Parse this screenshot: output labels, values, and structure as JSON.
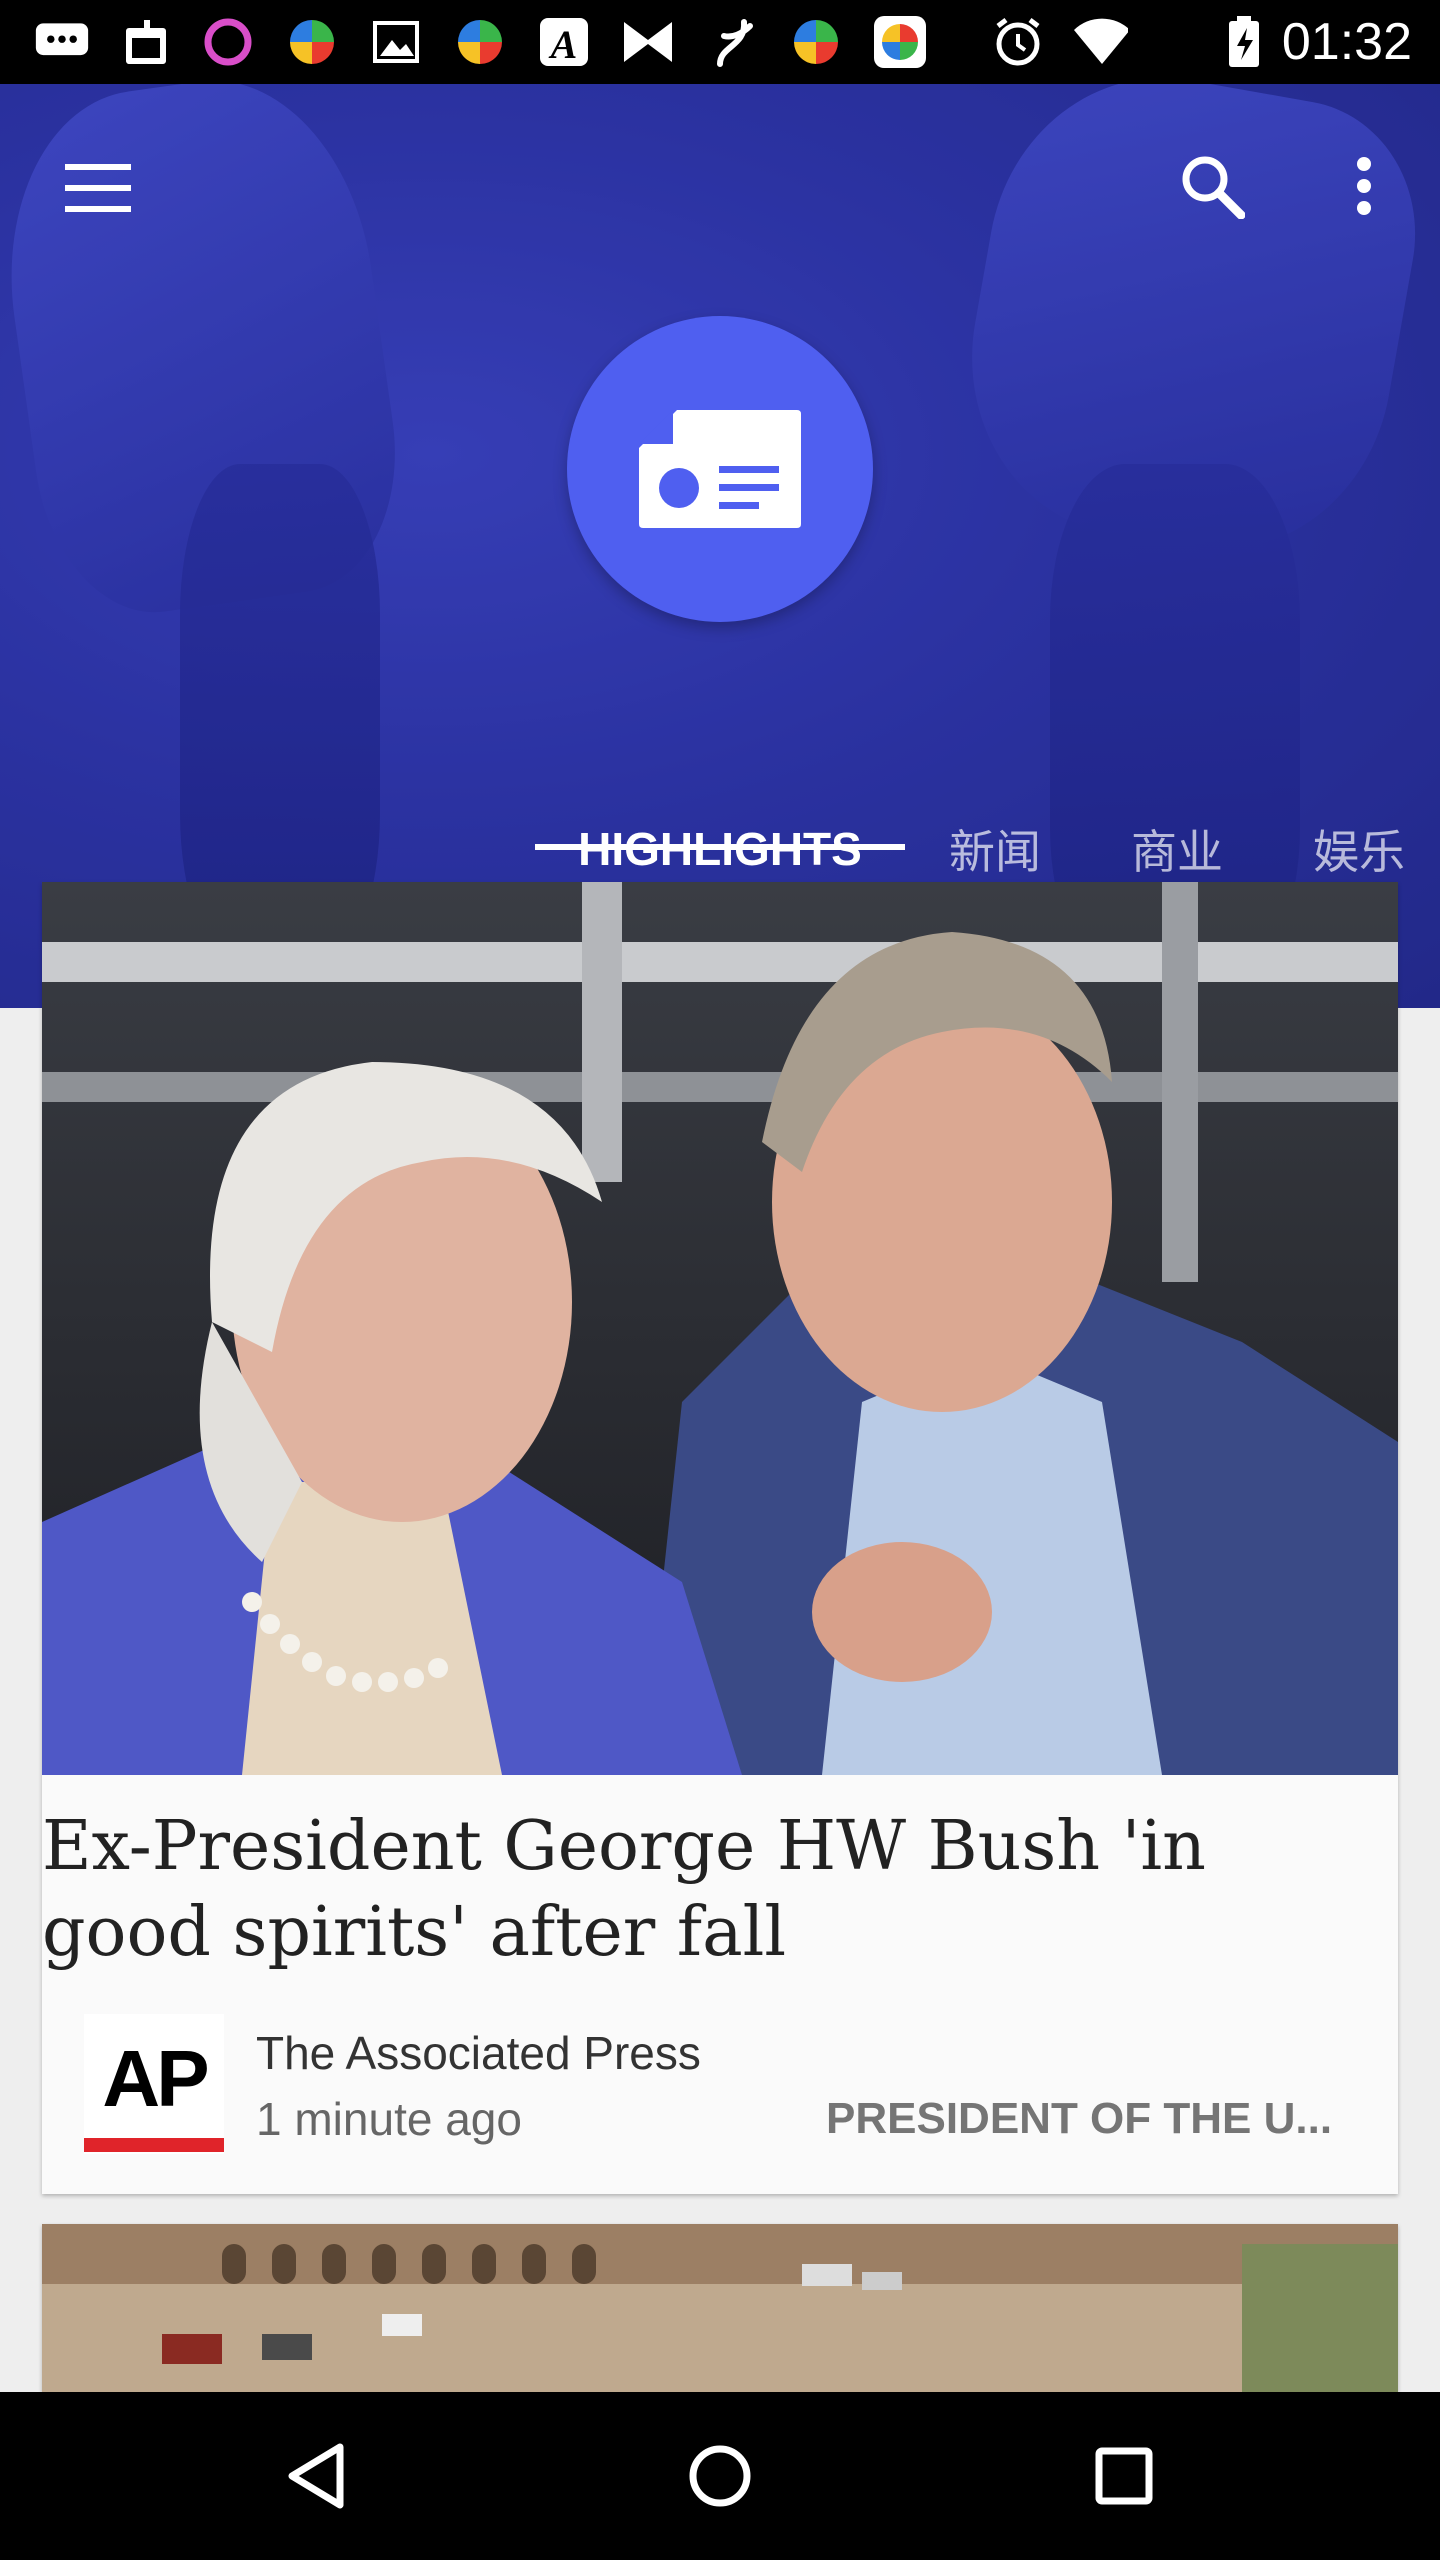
{
  "status_bar": {
    "time": "01:32",
    "icons": [
      "chat-icon",
      "calendar-icon",
      "ring-icon",
      "pinwheel-icon",
      "image-icon",
      "pinwheel-icon",
      "app-a-icon",
      "bowtie-icon",
      "fork-icon",
      "pinwheel-icon",
      "photos-icon",
      "alarm-icon",
      "wifi-icon",
      "battery-icon"
    ]
  },
  "header": {
    "menu_icon": "hamburger-menu-icon",
    "search_icon": "search-icon",
    "more_icon": "more-vertical-icon",
    "logo_icon": "news-logo-icon",
    "tabs": [
      {
        "label": "HIGHLIGHTS",
        "active": true
      },
      {
        "label": "新闻",
        "active": false
      },
      {
        "label": "商业",
        "active": false
      },
      {
        "label": "娱乐",
        "active": false
      }
    ]
  },
  "articles": [
    {
      "headline": "Ex-President George HW Bush 'in good spirits' after fall",
      "source": "The Associated Press",
      "source_logo_text": "AP",
      "time": "1 minute ago",
      "topic": "PRESIDENT OF THE U..."
    }
  ],
  "nav_bar": {
    "back_icon": "back-triangle-icon",
    "home_icon": "home-circle-icon",
    "recents_icon": "recents-square-icon"
  },
  "colors": {
    "accent": "#4f5ff0",
    "header_bg": "#2f37a8",
    "ap_red": "#e0242a"
  }
}
